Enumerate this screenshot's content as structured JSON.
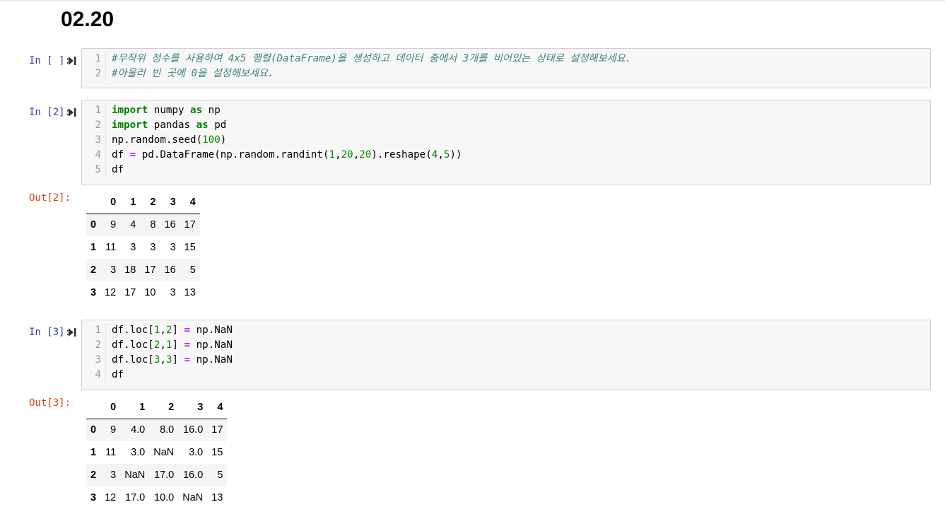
{
  "heading": "02.20",
  "cells": [
    {
      "prompt": "In [ ]:",
      "lines": [
        "#무작위 정수를 사용하여 4x5 행렬(DataFrame)을 생성하고 데이터 중에서 3개를 비어있는 상태로 설정해보세요.",
        "#아울러 빈 곳에 0을 설정해보세요."
      ]
    },
    {
      "prompt": "In [2]:",
      "lines": [
        "import numpy as np",
        "import pandas as pd",
        "np.random.seed(100)",
        "df = pd.DataFrame(np.random.randint(1,20,20).reshape(4,5))",
        "df"
      ],
      "out_prompt": "Out[2]:",
      "table": {
        "columns": [
          "0",
          "1",
          "2",
          "3",
          "4"
        ],
        "rows": [
          {
            "index": "0",
            "values": [
              "9",
              "4",
              "8",
              "16",
              "17"
            ]
          },
          {
            "index": "1",
            "values": [
              "11",
              "3",
              "3",
              "3",
              "15"
            ]
          },
          {
            "index": "2",
            "values": [
              "3",
              "18",
              "17",
              "16",
              "5"
            ]
          },
          {
            "index": "3",
            "values": [
              "12",
              "17",
              "10",
              "3",
              "13"
            ]
          }
        ]
      }
    },
    {
      "prompt": "In [3]:",
      "lines": [
        "df.loc[1,2] = np.NaN",
        "df.loc[2,1] = np.NaN",
        "df.loc[3,3] = np.NaN",
        "df"
      ],
      "out_prompt": "Out[3]:",
      "table": {
        "columns": [
          "0",
          "1",
          "2",
          "3",
          "4"
        ],
        "rows": [
          {
            "index": "0",
            "values": [
              "9",
              "4.0",
              "8.0",
              "16.0",
              "17"
            ]
          },
          {
            "index": "1",
            "values": [
              "11",
              "3.0",
              "NaN",
              "3.0",
              "15"
            ]
          },
          {
            "index": "2",
            "values": [
              "3",
              "NaN",
              "17.0",
              "16.0",
              "5"
            ]
          },
          {
            "index": "3",
            "values": [
              "12",
              "17.0",
              "10.0",
              "NaN",
              "13"
            ]
          }
        ]
      }
    }
  ]
}
